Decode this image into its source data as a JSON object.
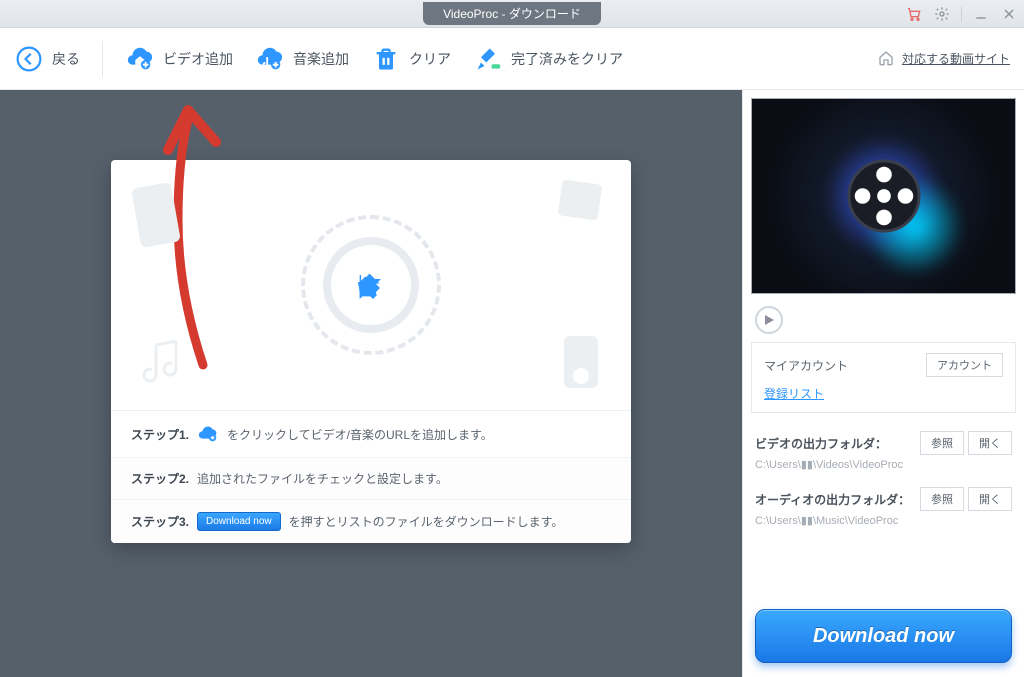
{
  "title": "VideoProc - ダウンロード",
  "toolbar": {
    "back": "戻る",
    "add_video": "ビデオ追加",
    "add_music": "音楽追加",
    "clear": "クリア",
    "clear_done": "完了済みをクリア",
    "supported_sites": "対応する動画サイト"
  },
  "steps": {
    "s1_label": "ステップ1.",
    "s1_text": "をクリックしてビデオ/音楽のURLを追加します。",
    "s2_label": "ステップ2.",
    "s2_text": "追加されたファイルをチェックと設定します。",
    "s3_label": "ステップ3.",
    "s3_btn": "Download now",
    "s3_text": "を押すとリストのファイルをダウンロードします。"
  },
  "account": {
    "label": "マイアカウント",
    "button": "アカウント",
    "register_link": "登録リスト"
  },
  "output": {
    "video_label": "ビデオの出力フォルダ：",
    "video_path": "C:\\Users\\▮▮\\Videos\\VideoProc",
    "audio_label": "オーディオの出力フォルダ：",
    "audio_path": "C:\\Users\\▮▮\\Music\\VideoProc",
    "browse": "参照",
    "open": "開く"
  },
  "download_button": "Download now"
}
